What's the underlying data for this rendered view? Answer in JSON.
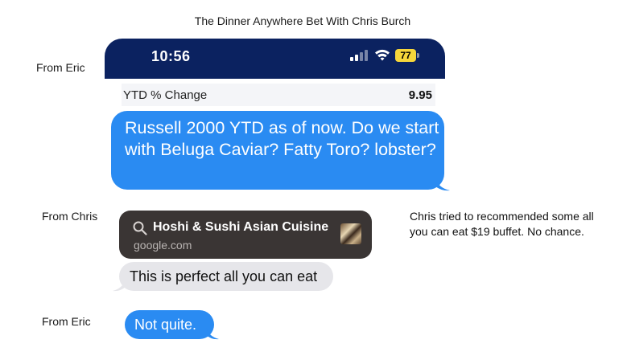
{
  "title": "The Dinner Anywhere Bet With Chris Burch",
  "labels": {
    "from_eric_1": "From Eric",
    "from_chris": "From Chris",
    "from_eric_2": "From Eric"
  },
  "status_bar": {
    "time": "10:56",
    "battery": "77",
    "background_color": "#0b2260",
    "battery_color": "#f6d63b"
  },
  "ytd": {
    "label": "YTD % Change",
    "value": "9.95"
  },
  "messages": {
    "eric_1": "Russell 2000 YTD as of now.  Do we start with Beluga Caviar? Fatty Toro? lobster?",
    "link_title": "Hoshi & Sushi Asian Cuisine",
    "link_url": "google.com",
    "chris_reply": "This is perfect all you can eat",
    "eric_2": "Not quite."
  },
  "note": "Chris tried to recommended some all you can eat $19 buffet. No chance.",
  "colors": {
    "blue_bubble": "#2a8bf2",
    "gray_bubble": "#e6e6ea",
    "link_card": "#3a3534"
  },
  "icons": [
    "signal-icon",
    "wifi-icon",
    "battery-icon",
    "search-icon",
    "restaurant-thumbnail"
  ]
}
